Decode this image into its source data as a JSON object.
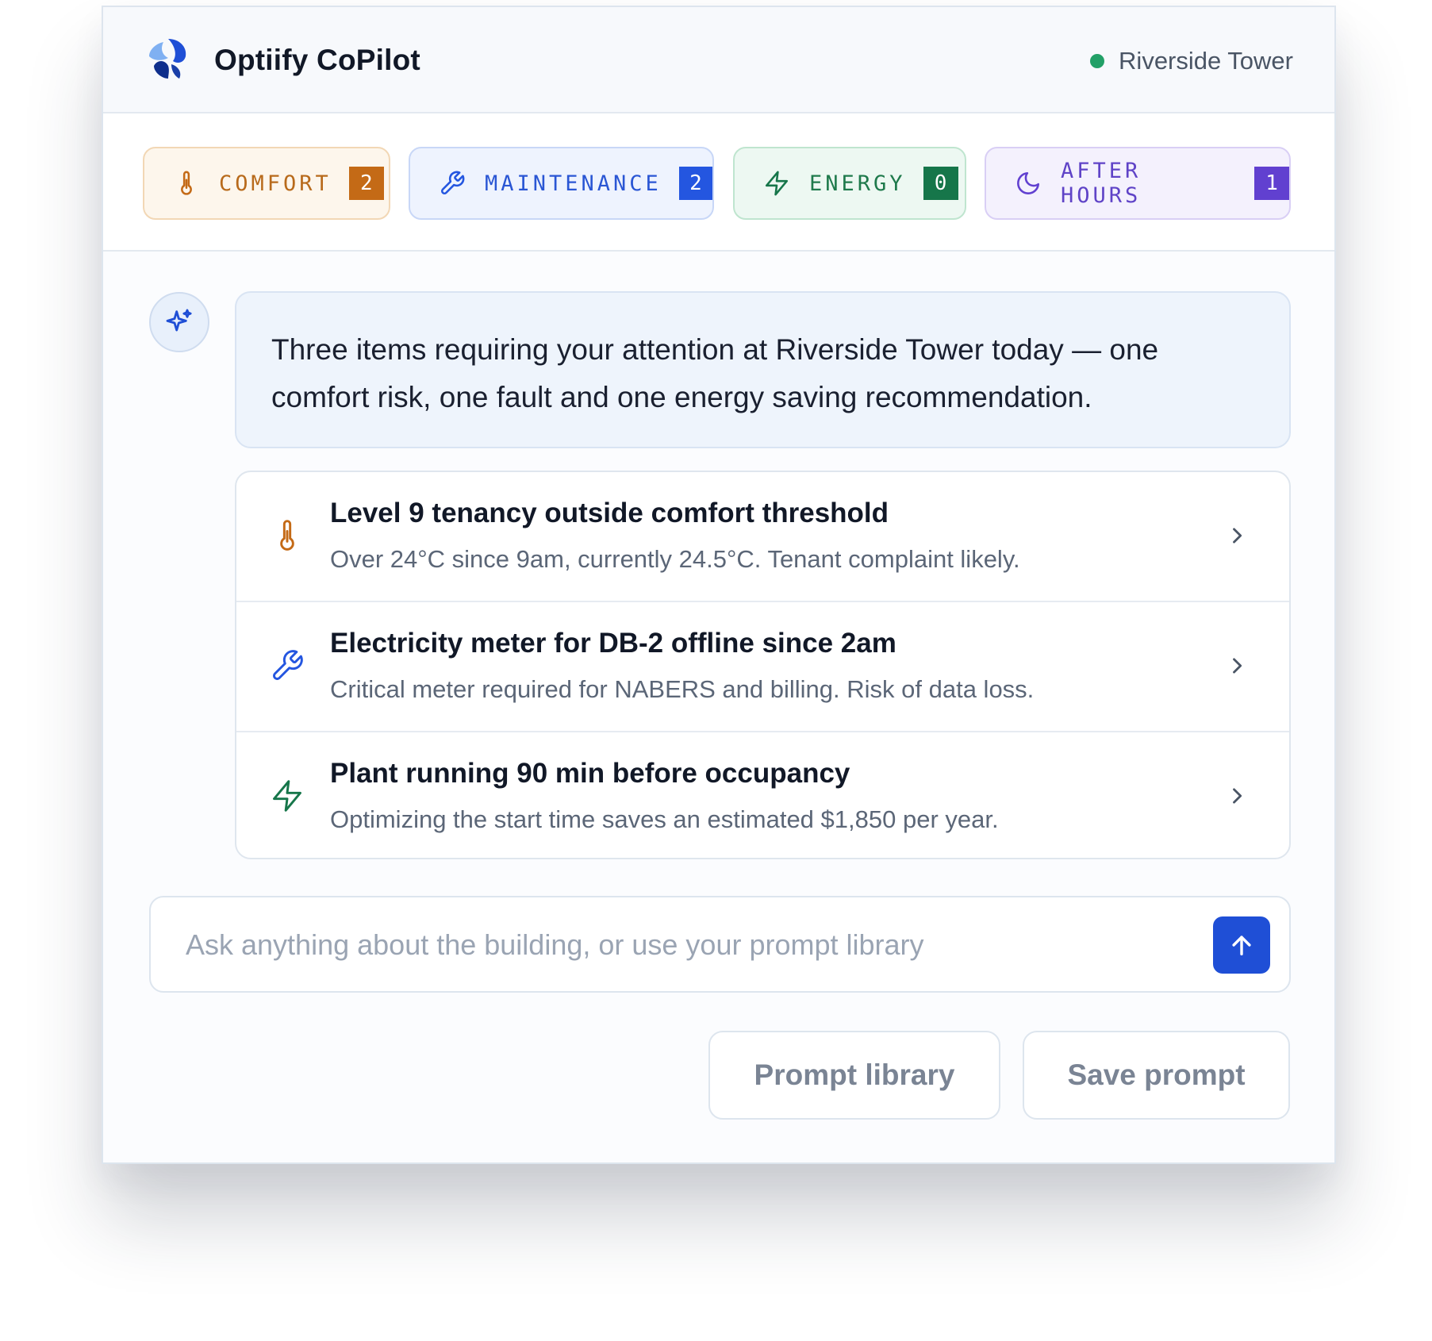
{
  "header": {
    "app_title": "Optiify CoPilot",
    "building": "Riverside Tower",
    "status_color": "#22a067",
    "logo_icon": "optiify-logo"
  },
  "filters": [
    {
      "label": "COMFORT",
      "count": "2",
      "icon": "thermometer-icon",
      "color": "#c46a16"
    },
    {
      "label": "MAINTENANCE",
      "count": "2",
      "icon": "wrench-icon",
      "color": "#2456e0"
    },
    {
      "label": "ENERGY",
      "count": "0",
      "icon": "lightning-icon",
      "color": "#16764a"
    },
    {
      "label": "AFTER HOURS",
      "count": "1",
      "icon": "moon-icon",
      "color": "#6140d0"
    }
  ],
  "message": {
    "avatar_icon": "sparkle-icon",
    "text": "Three items requiring your attention at Riverside Tower today — one comfort risk, one fault and one energy saving recommendation."
  },
  "items": [
    {
      "icon": "thermometer-icon",
      "title": "Level 9 tenancy outside comfort threshold",
      "description": "Over 24°C since 9am, currently 24.5°C. Tenant complaint likely."
    },
    {
      "icon": "wrench-icon",
      "title": "Electricity meter for DB-2 offline since 2am",
      "description": "Critical meter required for NABERS and billing. Risk of data loss."
    },
    {
      "icon": "lightning-icon",
      "title": "Plant running 90 min before occupancy",
      "description": "Optimizing the start time saves an estimated $1,850 per year."
    }
  ],
  "composer": {
    "placeholder": "Ask anything about the building, or use your prompt library",
    "value": "",
    "send_icon": "arrow-up-icon"
  },
  "actions": {
    "prompt_library": "Prompt library",
    "save_prompt": "Save prompt"
  }
}
